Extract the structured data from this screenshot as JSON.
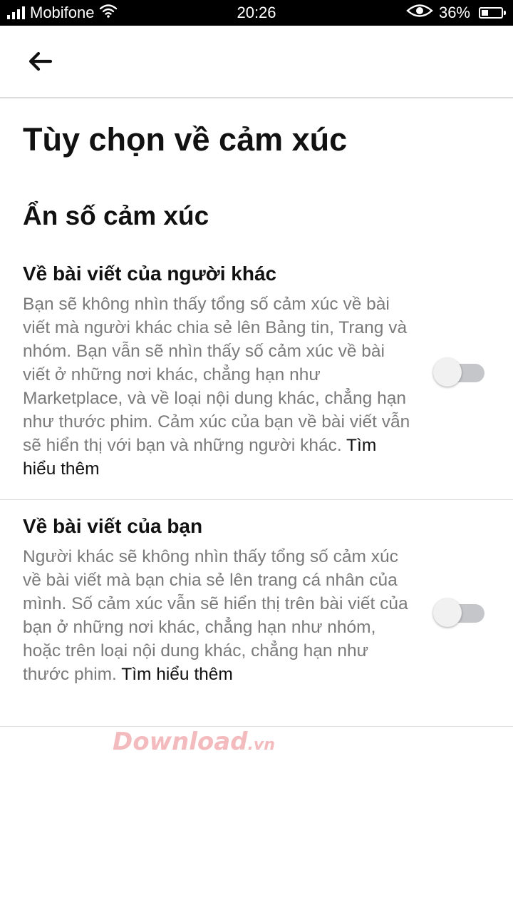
{
  "status_bar": {
    "carrier": "Mobifone",
    "time": "20:26",
    "battery": "36%",
    "battery_level": 0.36,
    "icons": [
      "signal-icon",
      "wifi-icon",
      "eye-icon",
      "battery-icon"
    ]
  },
  "header": {
    "back_icon": "back-arrow-icon"
  },
  "page": {
    "title": "Tùy chọn về cảm xúc",
    "section_heading": "Ẩn số cảm xúc"
  },
  "settings": [
    {
      "title": "Về bài viết của người khác",
      "description": "Bạn sẽ không nhìn thấy tổng số cảm xúc về bài viết mà người khác chia sẻ lên Bảng tin, Trang và nhóm. Bạn vẫn sẽ nhìn thấy số cảm xúc về bài viết ở những nơi khác, chẳng hạn như Marketplace, và về loại nội dung khác, chẳng hạn như thước phim. Cảm xúc của bạn về bài viết vẫn sẽ hiển thị với bạn và những người khác.",
      "learn_more": "Tìm hiểu thêm",
      "enabled": false
    },
    {
      "title": "Về bài viết của bạn",
      "description": "Người khác sẽ không nhìn thấy tổng số cảm xúc về bài viết mà bạn chia sẻ lên trang cá nhân của mình. Số cảm xúc vẫn sẽ hiển thị trên bài viết của bạn ở những nơi khác, chẳng hạn như nhóm, hoặc trên loại nội dung khác, chẳng hạn như thước phim.",
      "learn_more": "Tìm hiểu thêm",
      "enabled": false
    }
  ],
  "watermark": {
    "main": "Download",
    "tld": ".vn"
  },
  "colors": {
    "status_bar": "#000000",
    "toggle_off_track": "#c4c6c9",
    "description_text": "#7a7a7a",
    "divider": "#dddddd"
  }
}
